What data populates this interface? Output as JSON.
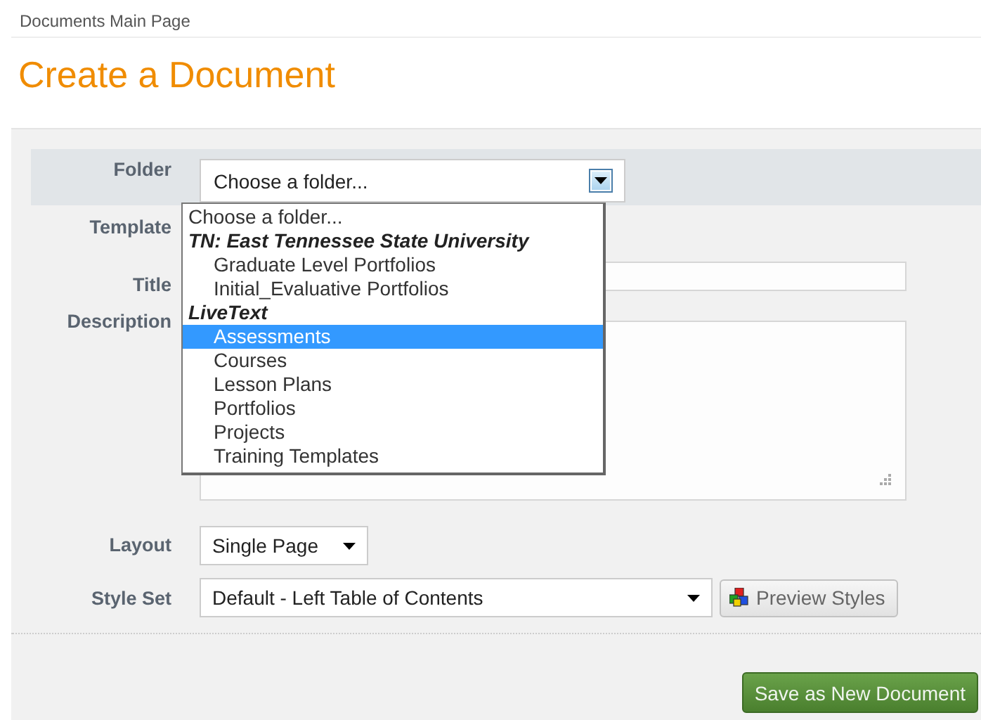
{
  "breadcrumb": "Documents Main Page",
  "heading": "Create a Document",
  "form": {
    "folder": {
      "label": "Folder",
      "value": "Choose a folder...",
      "expanded": true,
      "options": [
        {
          "kind": "option",
          "label": "Choose a folder...",
          "highlighted": false
        },
        {
          "kind": "group",
          "label": "TN: East Tennessee State University"
        },
        {
          "kind": "child",
          "label": "Graduate Level Portfolios",
          "highlighted": false
        },
        {
          "kind": "child",
          "label": "Initial_Evaluative Portfolios",
          "highlighted": false
        },
        {
          "kind": "group",
          "label": "LiveText"
        },
        {
          "kind": "child",
          "label": "Assessments",
          "highlighted": true
        },
        {
          "kind": "child",
          "label": "Courses",
          "highlighted": false
        },
        {
          "kind": "child",
          "label": "Lesson Plans",
          "highlighted": false
        },
        {
          "kind": "child",
          "label": "Portfolios",
          "highlighted": false
        },
        {
          "kind": "child",
          "label": "Projects",
          "highlighted": false
        },
        {
          "kind": "child",
          "label": "Training Templates",
          "highlighted": false
        }
      ]
    },
    "template": {
      "label": "Template"
    },
    "title": {
      "label": "Title"
    },
    "description": {
      "label": "Description"
    },
    "layout": {
      "label": "Layout",
      "value": "Single Page"
    },
    "style_set": {
      "label": "Style Set",
      "value": "Default - Left Table of Contents",
      "button": "Preview Styles"
    }
  },
  "save_button": "Save as New Document"
}
